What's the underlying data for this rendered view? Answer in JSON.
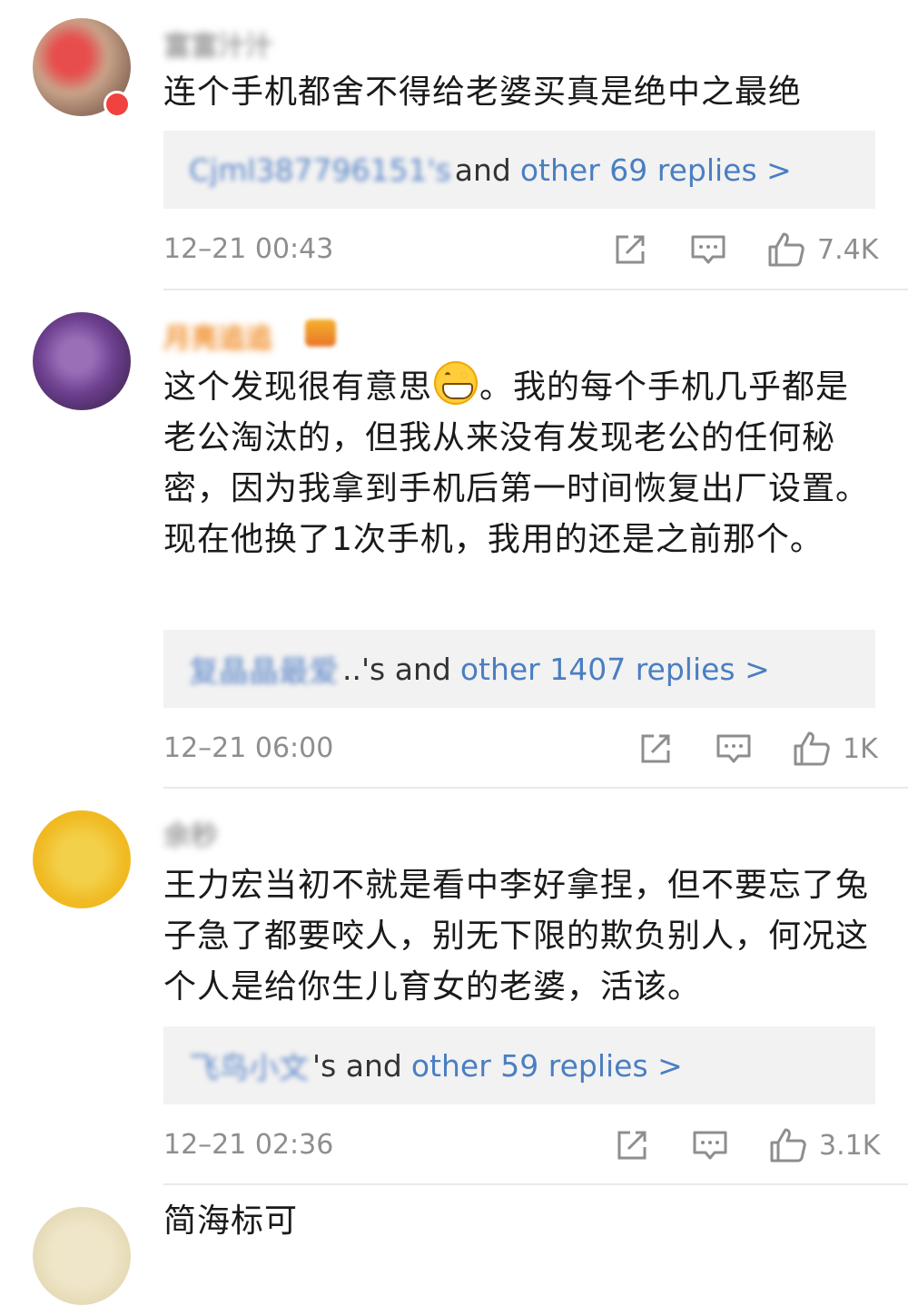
{
  "comments": [
    {
      "username": "富富汁汁",
      "text": "连个手机都舍不得给老婆买真是绝中之最绝",
      "reply_user": "Cjml387796151's",
      "reply_and": "and",
      "reply_more": "other 69 replies >",
      "time": "12–21 00:43",
      "likes": "7.4K"
    },
    {
      "username": "月亮追追",
      "text_before_emoji": "这个发现很有意思",
      "text_after_emoji": "。我的每个手机几乎都是老公淘汰的，但我从来没有发现老公的任何秘密，因为我拿到手机后第一时间恢复出厂设置。现在他换了1次手机，我用的还是之前那个。",
      "reply_user": "复晶晶最爱",
      "reply_and": "..'s and",
      "reply_more": "other 1407 replies >",
      "time": "12–21 06:00",
      "likes": "1K"
    },
    {
      "username": "余秒",
      "text": "王力宏当初不就是看中李好拿捏，但不要忘了兔子急了都要咬人，别无下限的欺负别人，何况这个人是给你生儿育女的老婆，活该。",
      "reply_user": "飞鸟小文",
      "reply_and": "'s and",
      "reply_more": "other 59 replies >",
      "time": "12–21 02:36",
      "likes": "3.1K"
    },
    {
      "text": "简海标可"
    }
  ],
  "icons": {
    "share": "share-icon",
    "comment": "comment-icon",
    "like": "thumbs-up-icon"
  },
  "colors": {
    "link": "#4a7ec2",
    "meta": "#8e8e8e",
    "reply_bg": "#f2f2f2",
    "vip_name": "#f08a24"
  }
}
